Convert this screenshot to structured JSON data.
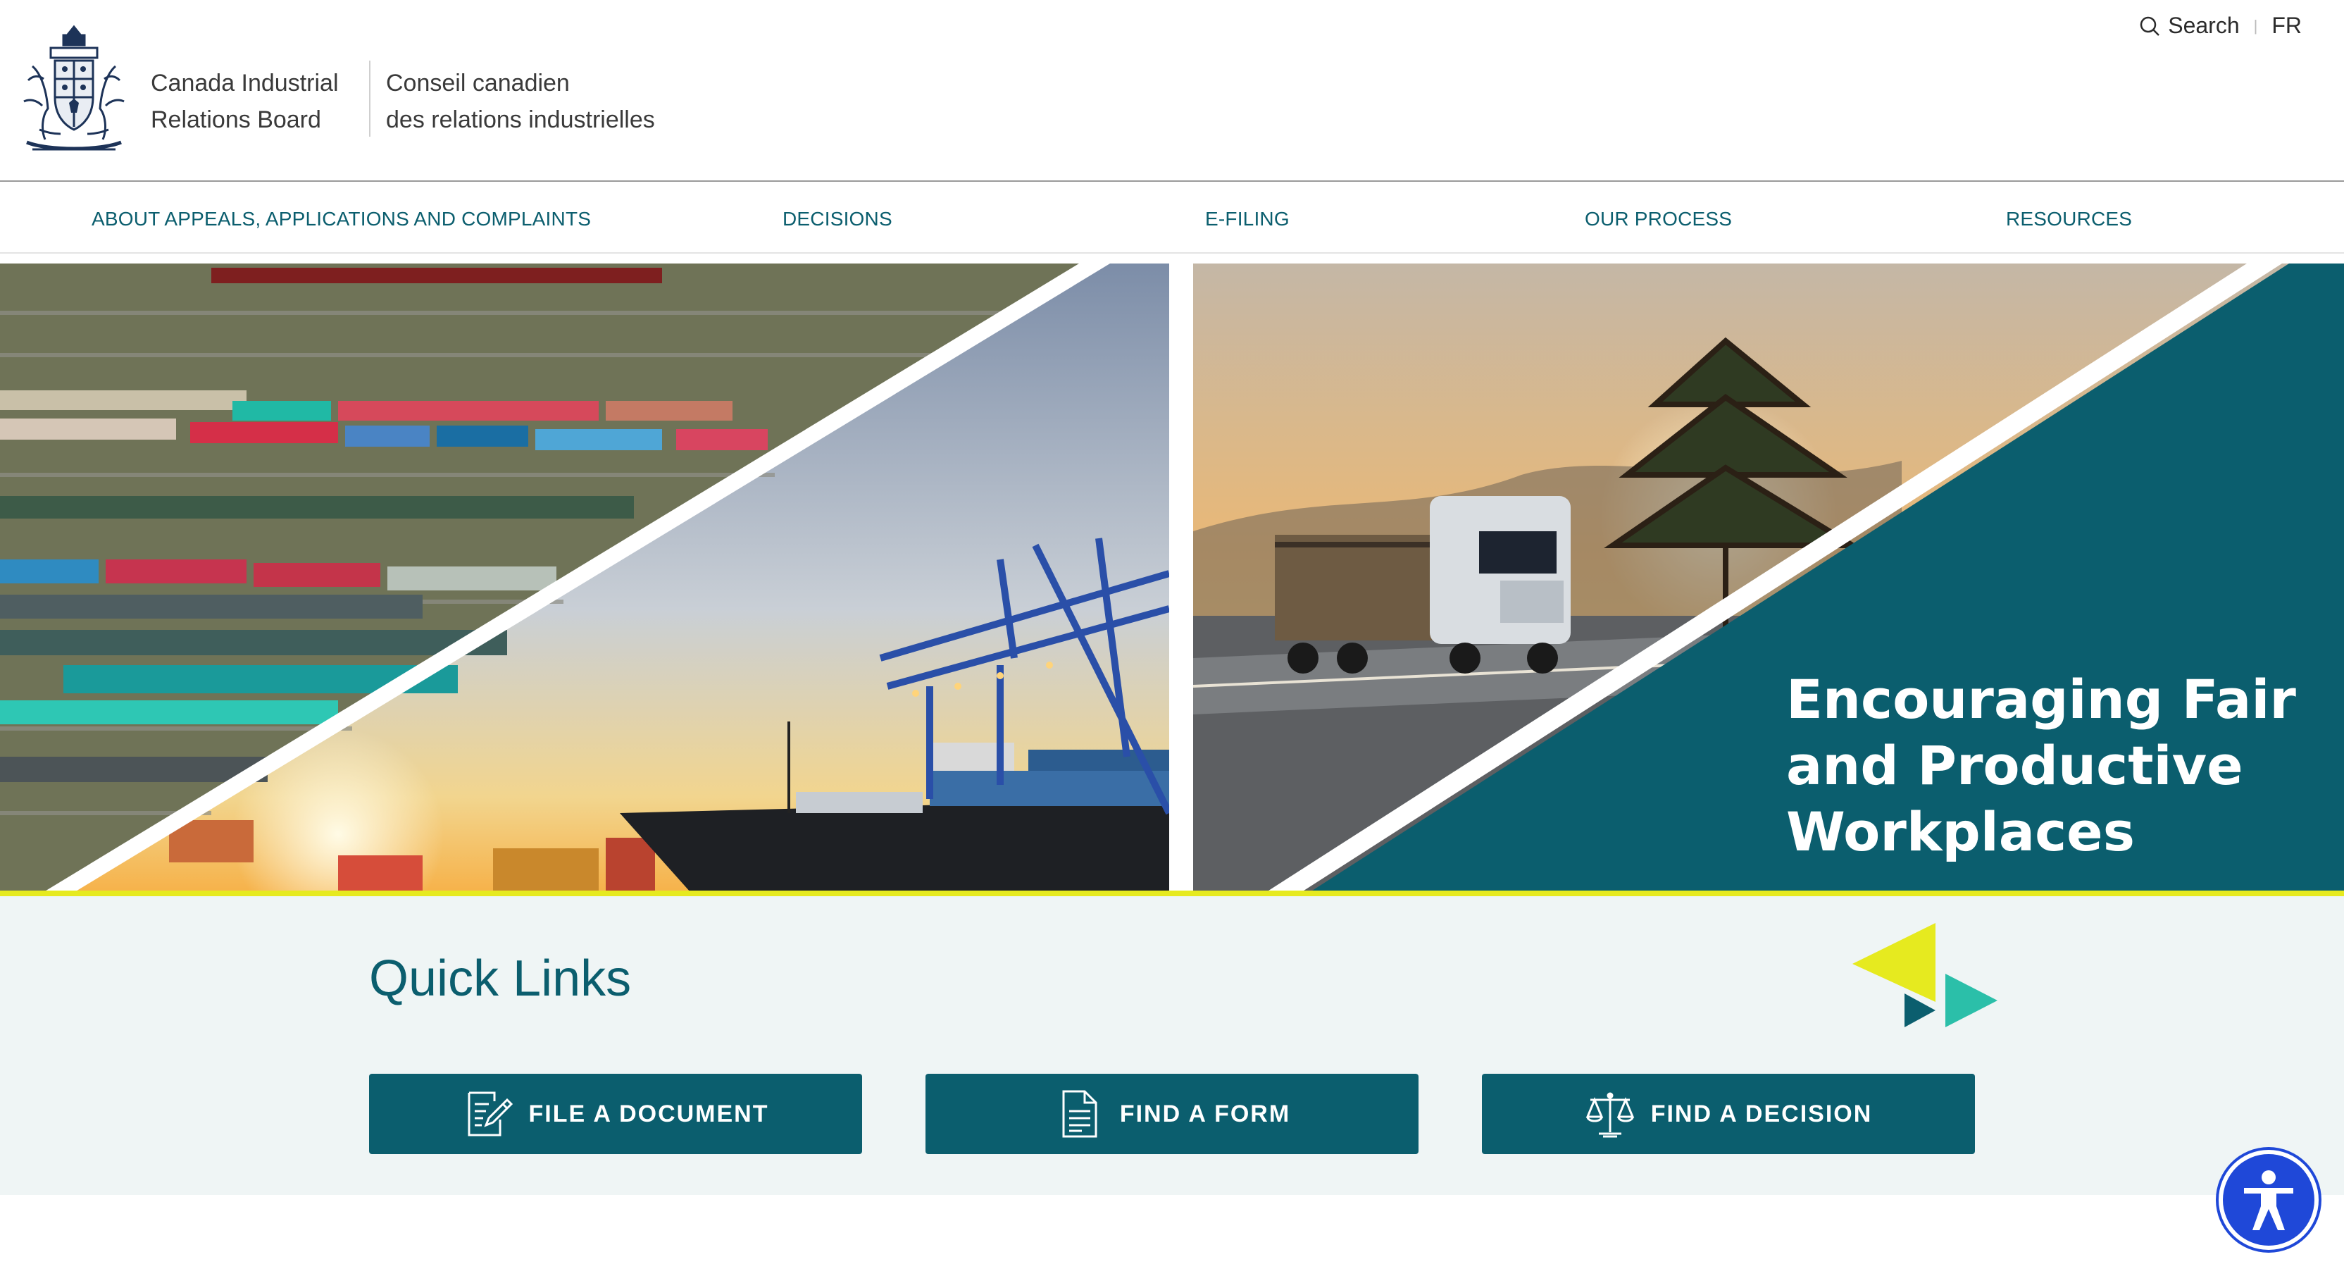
{
  "header": {
    "org_en_line1": "Canada Industrial",
    "org_en_line2": "Relations Board",
    "org_fr_line1": "Conseil canadien",
    "org_fr_line2": "des relations industrielles",
    "search_label": "Search",
    "lang_label": "FR"
  },
  "nav": {
    "items": [
      {
        "label": "ABOUT APPEALS, APPLICATIONS AND COMPLAINTS"
      },
      {
        "label": "DECISIONS"
      },
      {
        "label": "E-FILING"
      },
      {
        "label": "OUR PROCESS"
      },
      {
        "label": "RESOURCES"
      }
    ]
  },
  "hero": {
    "title_line1": "Encouraging Fair",
    "title_line2": "and Productive",
    "title_line3": "Workplaces"
  },
  "quick_links": {
    "title": "Quick Links",
    "buttons": [
      {
        "label": "FILE A DOCUMENT",
        "icon": "file-edit-icon"
      },
      {
        "label": "FIND A FORM",
        "icon": "document-icon"
      },
      {
        "label": "FIND A DECISION",
        "icon": "scales-icon"
      }
    ]
  },
  "colors": {
    "brand_teal": "#0b5e6e",
    "accent_yellow": "#e6ea1f",
    "accent_aqua": "#2bbfa9",
    "accessibility_blue": "#1f48d8"
  }
}
